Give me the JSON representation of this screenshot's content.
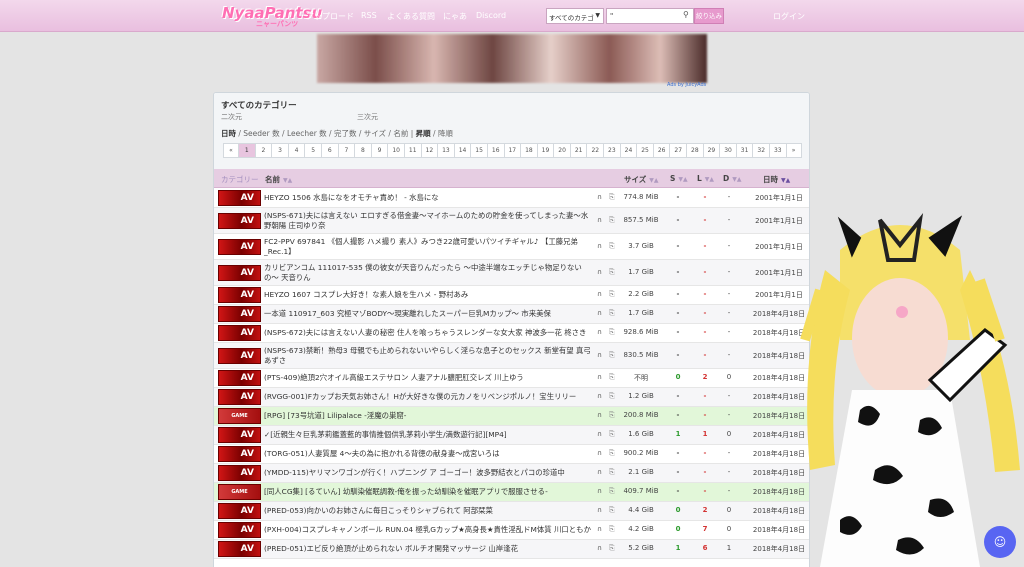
{
  "nav": {
    "logo": "NyaaPantsu",
    "logo_sub": "ニャーパンツ",
    "links": [
      "アップロード",
      "RSS",
      "よくある質問",
      "にゃあ",
      "Discord"
    ],
    "category_select": "すべてのカテゴ",
    "search_value": "\"",
    "search_button": "絞り込み",
    "login": "ログイン"
  },
  "ad": {
    "label": "Ads by JuicyAds"
  },
  "panel": {
    "title": "すべてのカテゴリー",
    "sub1": "二次元",
    "sub2": "三次元",
    "sort_options": [
      "日時",
      "Seeder 数",
      "Leecher 数",
      "完了数",
      "サイズ",
      "名前"
    ],
    "order_options": [
      "昇順",
      "降順"
    ]
  },
  "pagination": [
    "«",
    "1",
    "2",
    "3",
    "4",
    "5",
    "6",
    "7",
    "8",
    "9",
    "10",
    "11",
    "12",
    "13",
    "14",
    "15",
    "16",
    "17",
    "18",
    "19",
    "20",
    "21",
    "22",
    "23",
    "24",
    "25",
    "26",
    "27",
    "28",
    "29",
    "30",
    "31",
    "32",
    "33",
    "»"
  ],
  "table": {
    "headers": {
      "category": "カテゴリー",
      "name": "名前",
      "size": "サイズ",
      "s": "S",
      "l": "L",
      "d": "D",
      "date": "日時"
    },
    "rows": [
      {
        "cat": "AV",
        "name": "HEYZO 1506 水島になをオモチャ責め！ - 水島にな",
        "size": "774.8 MiB",
        "s": "-",
        "l": "-",
        "d": "-",
        "date": "2001年1月1日"
      },
      {
        "cat": "AV",
        "name": "(NSPS-671)夫には言えない エロすぎる借金妻〜マイホームのための貯金を使ってしまった妻〜水野朝陽 庄司ゆり奈",
        "size": "857.5 MiB",
        "s": "-",
        "l": "-",
        "d": "-",
        "date": "2001年1月1日"
      },
      {
        "cat": "AV",
        "name": "FC2-PPV 697841 《個人撮影 ハメ撮り 素人》みつき22歳可愛いパツイチギャル♪ 【工藤兄弟_Rec.1】",
        "size": "3.7 GiB",
        "s": "-",
        "l": "-",
        "d": "-",
        "date": "2001年1月1日"
      },
      {
        "cat": "AV",
        "name": "カリビアンコム 111017-535 僕の彼女が天音りんだったら 〜中途半端なエッチじゃ物足りないの〜 天音りん",
        "size": "1.7 GiB",
        "s": "-",
        "l": "-",
        "d": "-",
        "date": "2001年1月1日"
      },
      {
        "cat": "AV",
        "name": "HEYZO 1607 コスプレ大好き！な素人娘を生ハメ - 野村あみ",
        "size": "2.2 GiB",
        "s": "-",
        "l": "-",
        "d": "-",
        "date": "2001年1月1日"
      },
      {
        "cat": "AV",
        "name": "一本道 110917_603 究極マゾBODY〜現実離れしたスーパー巨乳Mカップ〜 市来美保",
        "size": "1.7 GiB",
        "s": "-",
        "l": "-",
        "d": "-",
        "date": "2018年4月18日"
      },
      {
        "cat": "AV",
        "name": "(NSPS-672)夫には言えない人妻の秘密 住人を喰っちゃうスレンダーな女大家 神波多一花 柊さき",
        "size": "928.6 MiB",
        "s": "-",
        "l": "-",
        "d": "-",
        "date": "2018年4月18日"
      },
      {
        "cat": "AV",
        "name": "(NSPS-673)禁断！熟母3 母親でも止められないいやらしく淫らな息子とのセックス 新堂有望 真弓あずさ",
        "size": "830.5 MiB",
        "s": "-",
        "l": "-",
        "d": "-",
        "date": "2018年4月18日"
      },
      {
        "cat": "AV",
        "name": "(PTS-409)絶頂2穴オイル高級エステサロン 人妻アナル膿肥肛交レズ 川上ゆう",
        "size": "不明",
        "s": "0",
        "l": "2",
        "d": "0",
        "date": "2018年4月18日"
      },
      {
        "cat": "AV",
        "name": "(RVGG-001)Fカップお天気お姉さん！Hが大好きな僕の元カノをリベンジポルノ！宝生リリー",
        "size": "1.2 GiB",
        "s": "-",
        "l": "-",
        "d": "-",
        "date": "2018年4月18日"
      },
      {
        "cat": "GAME",
        "name": "[RPG] [73号坑道] Lilipalace -淫魔の巣窟-",
        "size": "200.8 MiB",
        "s": "-",
        "l": "-",
        "d": "-",
        "date": "2018年4月18日"
      },
      {
        "cat": "AV",
        "name": "✓[近親生々巨乳茅莉鑑蓋藍的事情推個供乳茅莉小学生/満数遊行記][MP4]",
        "size": "1.6 GiB",
        "s": "1",
        "l": "1",
        "d": "0",
        "date": "2018年4月18日"
      },
      {
        "cat": "AV",
        "name": "(TORG-051)人妻質屋 4〜夫の為に抱かれる背徳の献身妻〜成宮いろは",
        "size": "900.2 MiB",
        "s": "-",
        "l": "-",
        "d": "-",
        "date": "2018年4月18日"
      },
      {
        "cat": "AV",
        "name": "(YMDD-115)ヤリマンワゴンが行く！ハプニング ア ゴーゴー！波多野結衣とパコの珍道中",
        "size": "2.1 GiB",
        "s": "-",
        "l": "-",
        "d": "-",
        "date": "2018年4月18日"
      },
      {
        "cat": "GAME",
        "name": "[同人CG集] [るていん] 幼馴染催眠調教-俺を振った幼馴染を催眠アプリで服服させる-",
        "size": "409.7 MiB",
        "s": "-",
        "l": "-",
        "d": "-",
        "date": "2018年4月18日"
      },
      {
        "cat": "AV",
        "name": "(PRED-053)向かいのお姉さんに毎日こっそりシャブられて 阿部栞菜",
        "size": "4.4 GiB",
        "s": "0",
        "l": "2",
        "d": "0",
        "date": "2018年4月18日"
      },
      {
        "cat": "AV",
        "name": "(PXH-004)コスプレキャノンボール RUN.04 極乳Gカップ★高身長★貴性淫乱ドM体質 川口ともか",
        "size": "4.2 GiB",
        "s": "0",
        "l": "7",
        "d": "0",
        "date": "2018年4月18日"
      },
      {
        "cat": "AV",
        "name": "(PRED-051)エビ反り絶頂が止められない ボルチオ開発マッサージ 山岸逢花",
        "size": "5.2 GiB",
        "s": "1",
        "l": "6",
        "d": "1",
        "date": "2018年4月18日"
      }
    ]
  },
  "colors": {
    "seeders": "#2e9b2e",
    "leechers": "#d33232",
    "nav_bg": "#ebc5e1",
    "game_row": "#e2f7d9"
  }
}
